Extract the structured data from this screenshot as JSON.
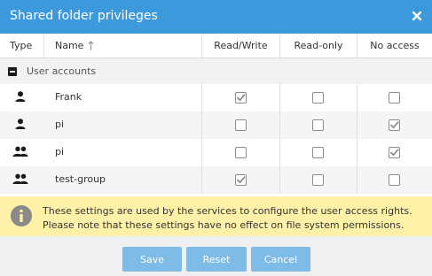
{
  "dialog": {
    "title": "Shared folder privileges",
    "close_icon": "close-icon"
  },
  "table": {
    "columns": {
      "type": "Type",
      "name": "Name",
      "read_write": "Read/Write",
      "read_only": "Read-only",
      "no_access": "No access"
    },
    "sort_icon": "sort-ascending-icon",
    "group": {
      "label": "User accounts",
      "icon": "collapse-icon"
    },
    "rows": [
      {
        "type_icon": "user-icon",
        "name": "Frank",
        "read_write": true,
        "read_only": false,
        "no_access": false
      },
      {
        "type_icon": "user-icon",
        "name": "pi",
        "read_write": false,
        "read_only": false,
        "no_access": true
      },
      {
        "type_icon": "group-icon",
        "name": "pi",
        "read_write": false,
        "read_only": false,
        "no_access": true
      },
      {
        "type_icon": "group-icon",
        "name": "test-group",
        "read_write": true,
        "read_only": false,
        "no_access": false
      }
    ]
  },
  "info": {
    "icon": "info-icon",
    "line1": "These settings are used by the services to configure the user access rights.",
    "line2": "Please note that these settings have no effect on file system permissions."
  },
  "buttons": {
    "save": "Save",
    "reset": "Reset",
    "cancel": "Cancel"
  },
  "colors": {
    "titlebar": "#3b99dc",
    "info_background": "#fff2a8",
    "button": "#7fbbe7",
    "checkmark": "#8c8c8c"
  }
}
